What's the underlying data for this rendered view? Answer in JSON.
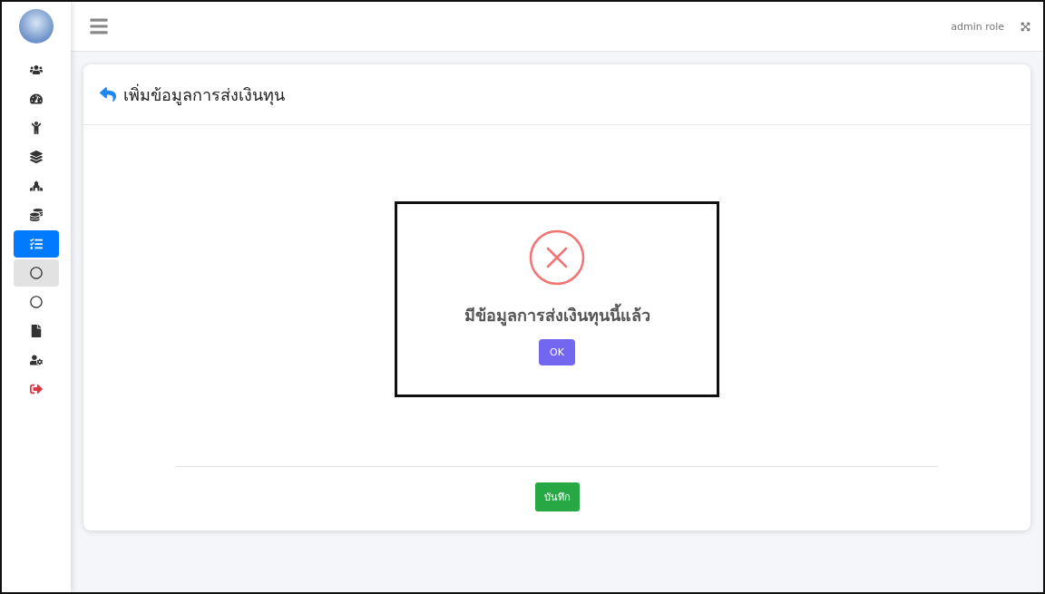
{
  "sidebar": {
    "items": [
      {
        "selected": false,
        "highlighted": false
      },
      {
        "selected": false,
        "highlighted": false
      },
      {
        "selected": false,
        "highlighted": false
      },
      {
        "selected": false,
        "highlighted": false
      },
      {
        "selected": false,
        "highlighted": false
      },
      {
        "selected": false,
        "highlighted": false
      },
      {
        "selected": true,
        "highlighted": false
      },
      {
        "selected": false,
        "highlighted": true
      },
      {
        "selected": false,
        "highlighted": false
      },
      {
        "selected": false,
        "highlighted": false
      },
      {
        "selected": false,
        "highlighted": false
      },
      {
        "selected": false,
        "highlighted": false
      }
    ]
  },
  "topbar": {
    "user": "admin role"
  },
  "card": {
    "title": "เพิ่มข้อมูลการส่งเงินทุน",
    "save_button": "บันทึก"
  },
  "dialog": {
    "message": "มีข้อมูลการส่งเงินทุนนี้แล้ว",
    "ok_button": "OK"
  }
}
